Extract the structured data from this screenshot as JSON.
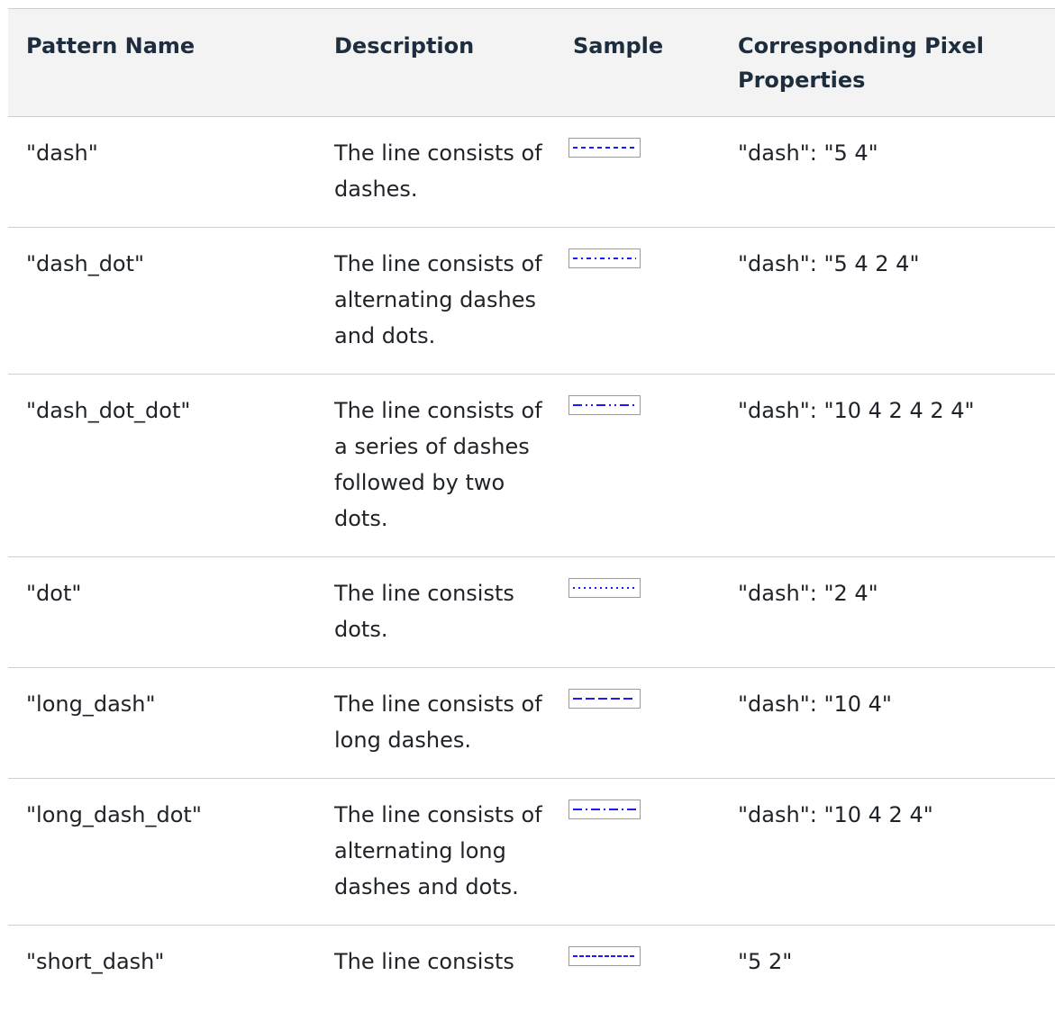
{
  "headers": {
    "pattern_name": "Pattern Name",
    "description": "Description",
    "sample": "Sample",
    "pixel_properties": "Corresponding Pixel Properties"
  },
  "sample_color": "#1a1aff",
  "rows": [
    {
      "name": "\"dash\"",
      "description": "The line consists of dashes.",
      "sample_icon": "dash-line-sample",
      "dasharray": "5 4",
      "pixel": "\"dash\": \"5 4\""
    },
    {
      "name": "\"dash_dot\"",
      "description": "The line consists of alternating dashes and dots.",
      "sample_icon": "dash-dot-line-sample",
      "dasharray": "5 4 2 4",
      "pixel": "\"dash\": \"5 4 2 4\""
    },
    {
      "name": "\"dash_dot_dot\"",
      "description": "The line consists of a series of dashes followed by two dots.",
      "sample_icon": "dash-dot-dot-line-sample",
      "dasharray": "10 4 2 4 2 4",
      "pixel": "\"dash\": \"10 4 2 4 2 4\""
    },
    {
      "name": "\"dot\"",
      "description": "The line consists dots.",
      "sample_icon": "dot-line-sample",
      "dasharray": "2 4",
      "pixel": "\"dash\": \"2 4\""
    },
    {
      "name": "\"long_dash\"",
      "description": "The line consists of long dashes.",
      "sample_icon": "long-dash-line-sample",
      "dasharray": "10 4",
      "pixel": "\"dash\": \"10 4\""
    },
    {
      "name": "\"long_dash_dot\"",
      "description": "The line consists of alternating long dashes and dots.",
      "sample_icon": "long-dash-dot-line-sample",
      "dasharray": "10 4 2 4",
      "pixel": "\"dash\": \"10 4 2 4\""
    },
    {
      "name": "\"short_dash\"",
      "description": "The line consists",
      "sample_icon": "short-dash-line-sample",
      "dasharray": "5 2",
      "pixel": "\"5 2\""
    }
  ]
}
